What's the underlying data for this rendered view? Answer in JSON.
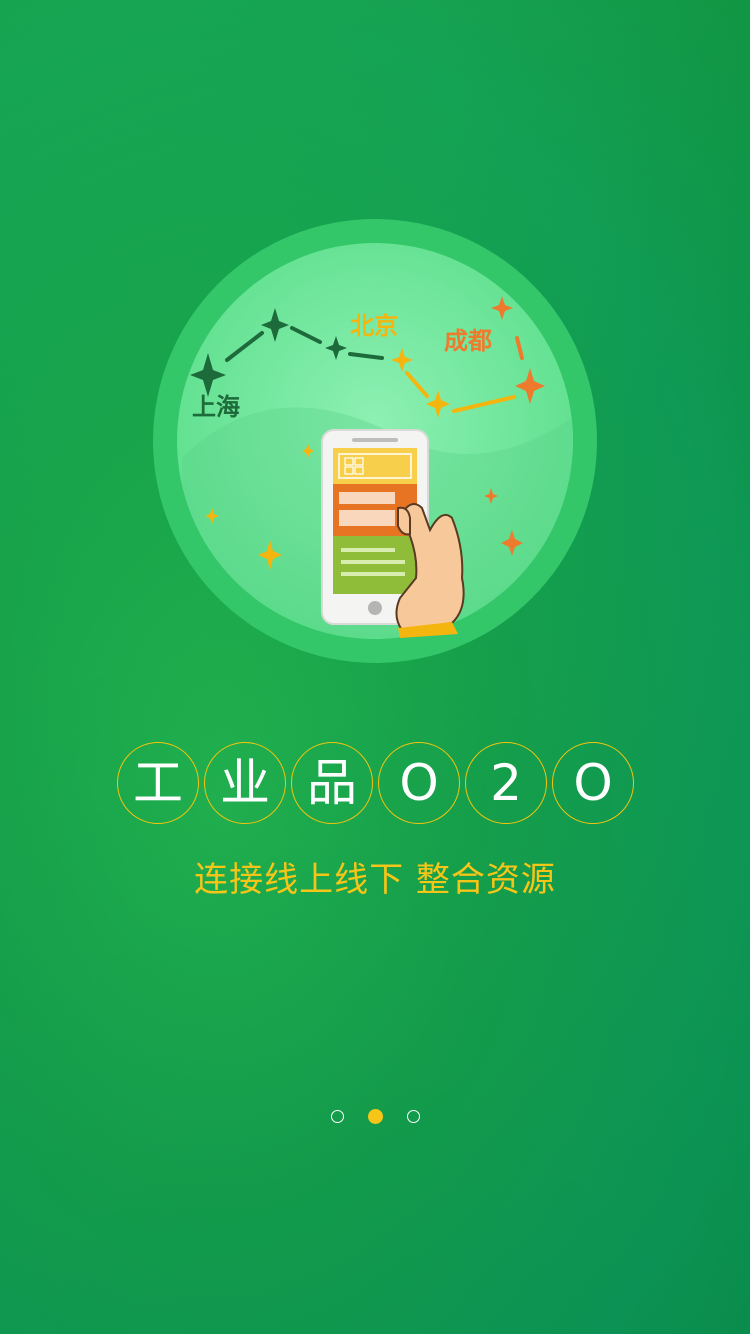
{
  "illustration": {
    "cities": {
      "shanghai": "上海",
      "beijing": "北京",
      "chengdu": "成都"
    }
  },
  "title_chars": [
    "工",
    "业",
    "品",
    "O",
    "2",
    "O"
  ],
  "subtitle": "连接线上线下 整合资源",
  "pager": {
    "count": 3,
    "active_index": 1
  },
  "colors": {
    "accent": "#f5c518",
    "bg_green": "#17a24a",
    "circle_light": "#6ee59a",
    "orange": "#ee7a2e",
    "dark_green": "#1d6a3a"
  }
}
